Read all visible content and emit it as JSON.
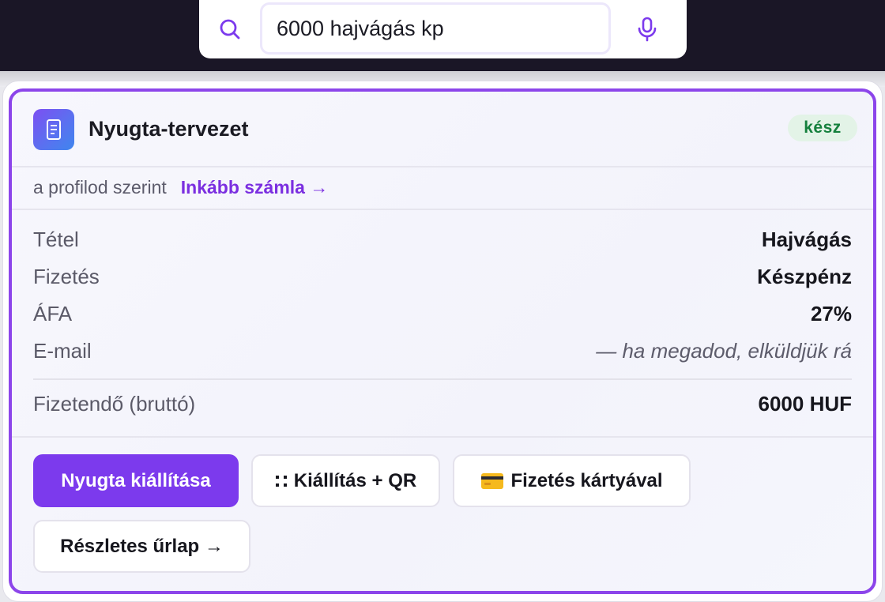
{
  "search": {
    "value": "6000 hajvágás kp",
    "search_icon": "search-icon",
    "mic_icon": "microphone-icon"
  },
  "card": {
    "icon": "receipt-icon",
    "title": "Nyugta-tervezet",
    "status": "kész",
    "subtitle": "a profilod szerint",
    "alt_link": "Inkább számla →",
    "rows": [
      {
        "label": "Tétel",
        "value": "Hajvágás"
      },
      {
        "label": "Fizetés",
        "value": "Készpénz"
      },
      {
        "label": "ÁFA",
        "value": "27%"
      },
      {
        "label": "E-mail",
        "value": "— ha megadod, elküldjük rá"
      }
    ],
    "total": {
      "label": "Fizetendő (bruttó)",
      "value": "6000 HUF"
    },
    "actions": {
      "issue": "Nyugta kiállítása",
      "issue_qr": "Kiállítás + QR",
      "pay_card": "Fizetés kártyával",
      "detailed_form": "Részletes űrlap →"
    }
  },
  "colors": {
    "accent": "#7c3aed",
    "status_green": "#15803d",
    "topbar": "#1a1626"
  }
}
